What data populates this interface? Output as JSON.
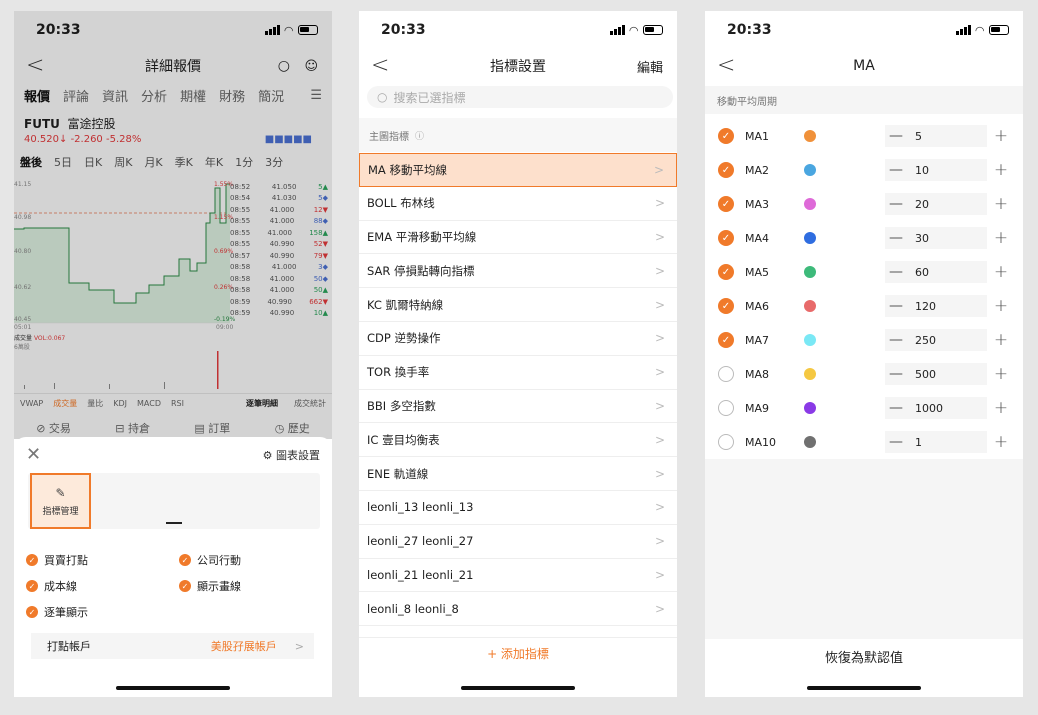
{
  "p1": {
    "time": "20:33",
    "title": "詳細報價",
    "tabs": [
      "報價",
      "評論",
      "資訊",
      "分析",
      "期權",
      "財務",
      "簡況"
    ],
    "code": "FUTU",
    "name": "富途控股",
    "price": "40.520",
    "change": "-2.260",
    "pct": "-5.28%",
    "timeframes": [
      "盤後",
      "5日",
      "日K",
      "周K",
      "月K",
      "季K",
      "年K",
      "1分",
      "3分"
    ],
    "trades": [
      {
        "t": "08:52",
        "p": "41.050",
        "q": "5",
        "d": "up"
      },
      {
        "t": "08:54",
        "p": "41.030",
        "q": "5",
        "d": "neu"
      },
      {
        "t": "08:55",
        "p": "41.000",
        "q": "12",
        "d": "dn"
      },
      {
        "t": "08:55",
        "p": "41.000",
        "q": "88",
        "d": "neu"
      },
      {
        "t": "08:55",
        "p": "41.000",
        "q": "158",
        "d": "up"
      },
      {
        "t": "08:55",
        "p": "40.990",
        "q": "52",
        "d": "dn"
      },
      {
        "t": "08:57",
        "p": "40.990",
        "q": "79",
        "d": "dn"
      },
      {
        "t": "08:58",
        "p": "41.000",
        "q": "3",
        "d": "neu"
      },
      {
        "t": "08:58",
        "p": "41.000",
        "q": "50",
        "d": "neu"
      },
      {
        "t": "08:58",
        "p": "41.000",
        "q": "50",
        "d": "up"
      },
      {
        "t": "08:59",
        "p": "40.990",
        "q": "662",
        "d": "dn"
      },
      {
        "t": "08:59",
        "p": "40.990",
        "q": "10",
        "d": "up"
      }
    ],
    "axis": {
      "hi": "41.15",
      "mid1": "40.98",
      "mid2": "40.80",
      "lo1": "40.62",
      "lo2": "40.45",
      "pct1": "1.55%",
      "pct2": "1.15%",
      "pct3": "0.69%",
      "pct4": "0.26%",
      "pct5": "-0.19%",
      "t0": "05:01",
      "t1": "09:00",
      "vol": "成交量",
      "volv": "VOL:0.067",
      "volunit": "6萬股"
    },
    "ind_tabs": [
      "VWAP",
      "成交量",
      "量比",
      "KDJ",
      "MACD",
      "RSI"
    ],
    "ind_right": [
      "逐筆明細",
      "成交統計"
    ],
    "bottom_tabs": [
      "交易",
      "持倉",
      "訂單",
      "歷史"
    ],
    "sheet": {
      "settings": "圖表設置",
      "manager": "指標管理",
      "options": [
        "買賣打點",
        "公司行動",
        "成本線",
        "顯示畫線",
        "逐筆顯示"
      ],
      "account_label": "打點帳戶",
      "account_value": "美股孖展帳戶"
    }
  },
  "p2": {
    "time": "20:33",
    "title": "指標設置",
    "edit": "編輯",
    "search_placeholder": "搜索已選指標",
    "section": "主圖指標",
    "items": [
      "MA 移動平均線",
      "BOLL 布林线",
      "EMA 平滑移動平均線",
      "SAR 停損點轉向指標",
      "KC 凱爾特納線",
      "CDP 逆勢操作",
      "TOR 換手率",
      "BBI 多空指數",
      "IC 壹目均衡表",
      "ENE 軌道線",
      "leonli_13 leonli_13",
      "leonli_27 leonli_27",
      "leonli_21 leonli_21",
      "leonli_8 leonli_8"
    ],
    "add": "+ 添加指標"
  },
  "p3": {
    "time": "20:33",
    "title": "MA",
    "section": "移動平均周期",
    "rows": [
      {
        "name": "MA1",
        "val": "5",
        "on": true,
        "color": "#f0913a"
      },
      {
        "name": "MA2",
        "val": "10",
        "on": true,
        "color": "#4aa6e0"
      },
      {
        "name": "MA3",
        "val": "20",
        "on": true,
        "color": "#de6ad8"
      },
      {
        "name": "MA4",
        "val": "30",
        "on": true,
        "color": "#2f6de0"
      },
      {
        "name": "MA5",
        "val": "60",
        "on": true,
        "color": "#3dba7a"
      },
      {
        "name": "MA6",
        "val": "120",
        "on": true,
        "color": "#e86a6a"
      },
      {
        "name": "MA7",
        "val": "250",
        "on": true,
        "color": "#7ae8f5"
      },
      {
        "name": "MA8",
        "val": "500",
        "on": false,
        "color": "#f5c842"
      },
      {
        "name": "MA9",
        "val": "1000",
        "on": false,
        "color": "#8a3ae6"
      },
      {
        "name": "MA10",
        "val": "1",
        "on": false,
        "color": "#707070"
      }
    ],
    "reset": "恢復為默認值"
  }
}
